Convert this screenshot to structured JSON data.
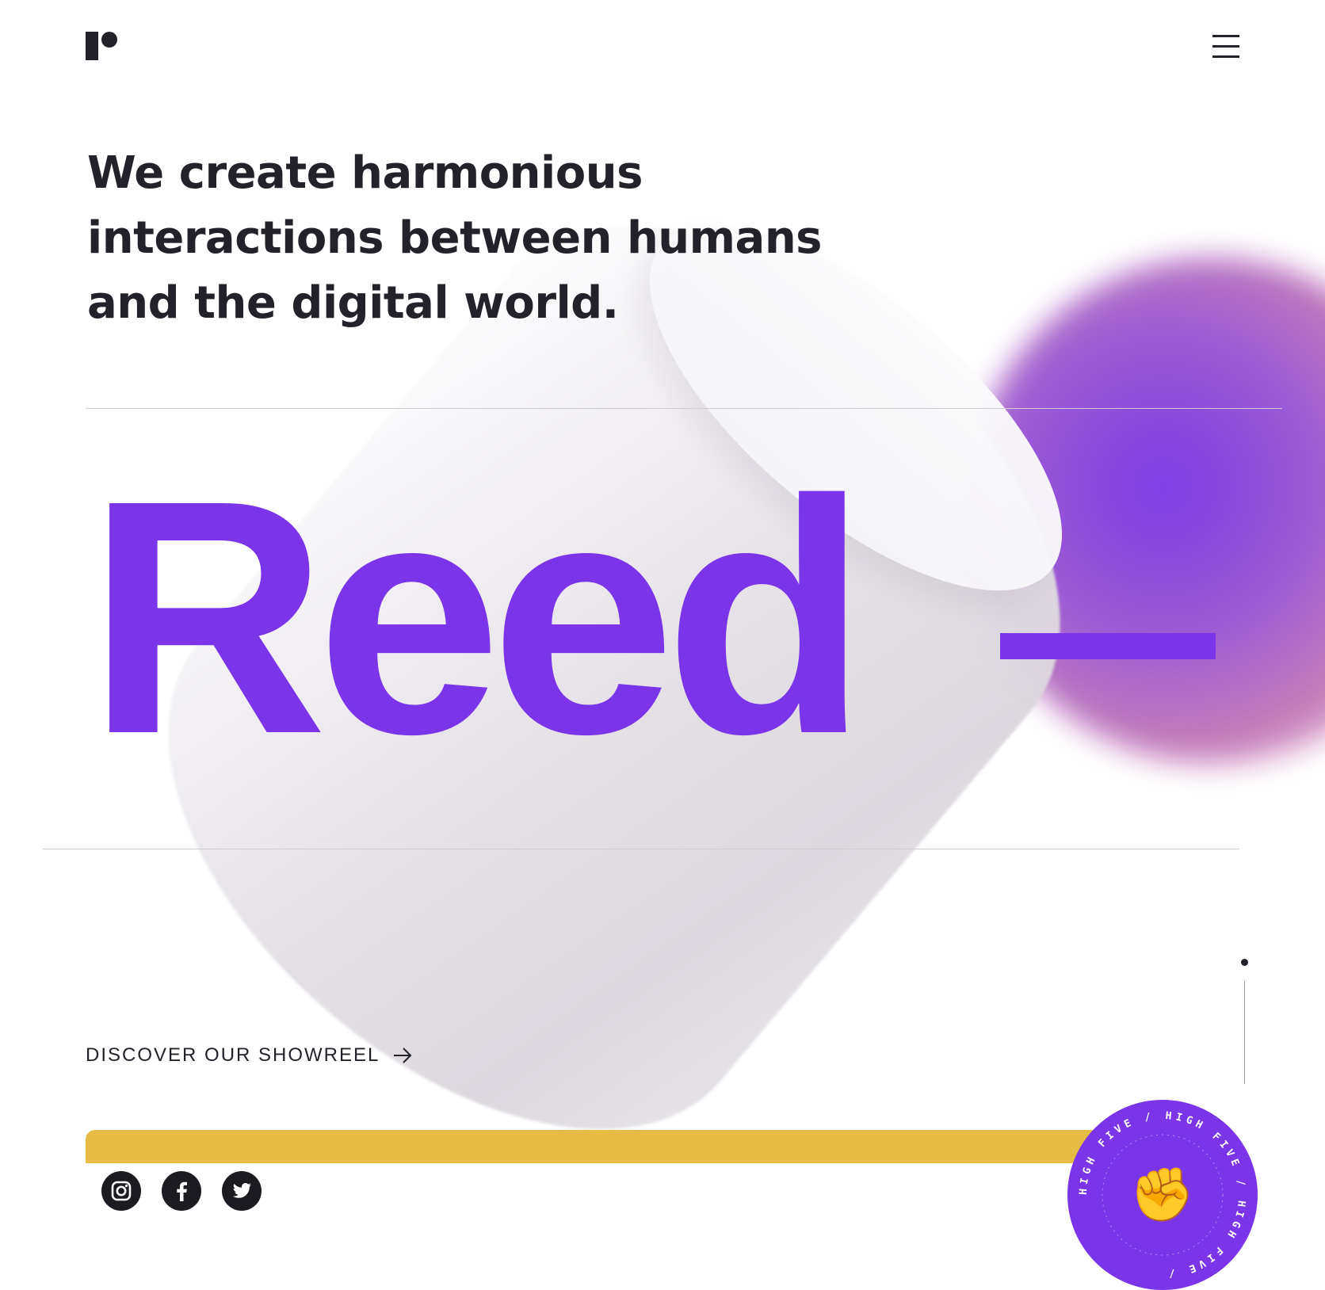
{
  "header": {
    "logo_icon": "reed-logo-icon",
    "menu_icon": "hamburger-menu-icon"
  },
  "hero": {
    "tagline_lines": [
      "We create harmonious",
      "interactions between humans",
      "and the digital world."
    ],
    "wordmark": "Reed"
  },
  "showreel": {
    "label": "DISCOVER OUR SHOWREEL",
    "icon": "arrow-right-icon"
  },
  "social": [
    {
      "name": "instagram",
      "icon": "instagram-icon"
    },
    {
      "name": "facebook",
      "icon": "facebook-icon"
    },
    {
      "name": "twitter",
      "icon": "twitter-icon"
    }
  ],
  "badge": {
    "ring_text": "HIGH FIVE / HIGH FIVE / HIGH FIVE / ",
    "emoji": "✊",
    "icon": "raised-fist-icon"
  },
  "colors": {
    "accent": "#7b34e8",
    "text": "#23222b",
    "yellow": "#e7bc45",
    "rule": "#cfcdd2"
  }
}
